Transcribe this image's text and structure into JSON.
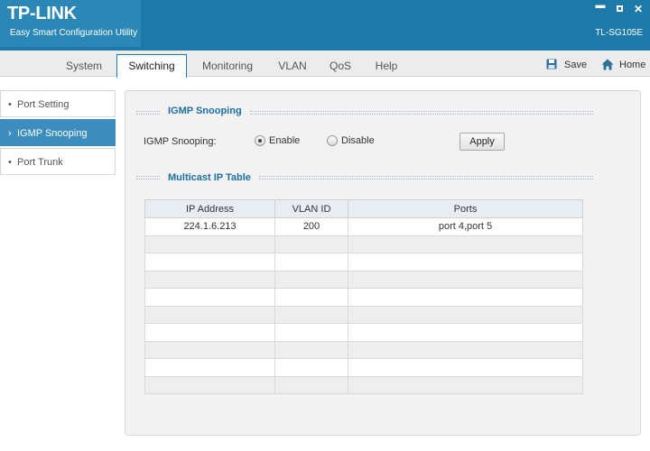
{
  "titlebar": {
    "logo": "TP-LINK",
    "subtitle": "Easy Smart Configuration Utility",
    "model": "TL-SG105E"
  },
  "window_controls": {
    "minimize": "▬",
    "close": "✕"
  },
  "tabs": [
    {
      "label": "System",
      "active": false
    },
    {
      "label": "Switching",
      "active": true
    },
    {
      "label": "Monitoring",
      "active": false
    },
    {
      "label": "VLAN",
      "active": false
    },
    {
      "label": "QoS",
      "active": false
    },
    {
      "label": "Help",
      "active": false
    }
  ],
  "toolbar": {
    "save_label": "Save",
    "save_icon": "floppy-disk-icon",
    "home_label": "Home",
    "home_icon": "house-icon"
  },
  "sidebar": {
    "bullet": "•",
    "active_bullet": "›",
    "items": [
      {
        "label": "Port Setting",
        "active": false
      },
      {
        "label": "IGMP Snooping",
        "active": true
      },
      {
        "label": "Port Trunk",
        "active": false
      }
    ]
  },
  "igmp": {
    "section_title": "IGMP Snooping",
    "field_label": "IGMP Snooping:",
    "enable_label": "Enable",
    "disable_label": "Disable",
    "selected": "Enable",
    "apply_label": "Apply"
  },
  "multicast": {
    "section_title": "Multicast IP Table",
    "headers": [
      "IP Address",
      "VLAN ID",
      "Ports"
    ],
    "rows": [
      [
        "224.1.6.213",
        "200",
        "port 4,port 5"
      ],
      [
        "",
        "",
        ""
      ],
      [
        "",
        "",
        ""
      ],
      [
        "",
        "",
        ""
      ],
      [
        "",
        "",
        ""
      ],
      [
        "",
        "",
        ""
      ],
      [
        "",
        "",
        ""
      ],
      [
        "",
        "",
        ""
      ],
      [
        "",
        "",
        ""
      ],
      [
        "",
        "",
        ""
      ]
    ]
  },
  "colors": {
    "brand_blue": "#1d7aa8",
    "active_nav": "#3d8dbf",
    "section_title": "#1d6fa0"
  }
}
